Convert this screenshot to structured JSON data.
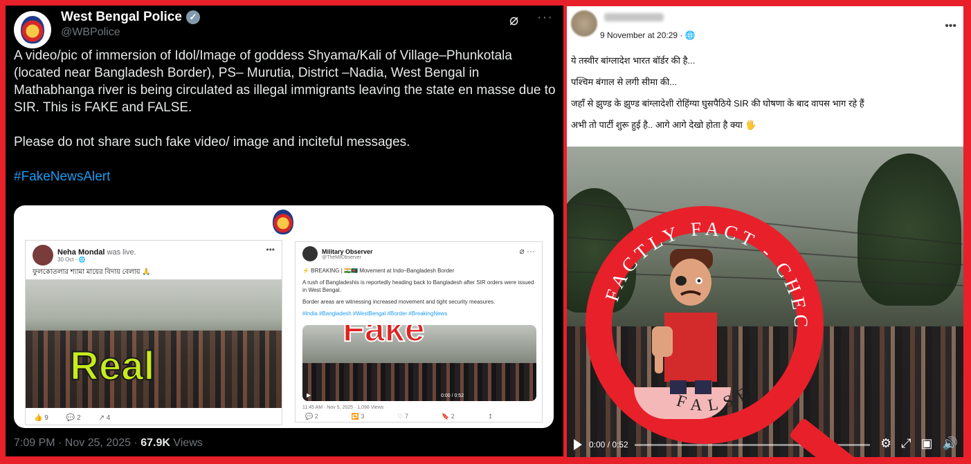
{
  "tweet": {
    "name": "West Bengal Police",
    "handle": "@WBPolice",
    "grok_icon": "slash-circle-icon",
    "more_icon": "ellipsis-icon",
    "paragraph_1": "A video/pic of immersion of Idol/Image of goddess Shyama/Kali  of Village–Phunkotala (located near Bangladesh Border), PS– Murutia, District –Nadia, West Bengal in Mathabhanga river is being circulated as illegal immigrants leaving the state en masse due to SIR. This is FAKE and FALSE.",
    "paragraph_2": "Please do not share such fake video/ image and inciteful messages.",
    "hashtag": "#FakeNewsAlert",
    "timestamp": "7:09 PM · Nov 25, 2025 · ",
    "views_count": "67.9K",
    "views_label": " Views",
    "media": {
      "left_card": {
        "name": "Neha Mondal",
        "name_suffix": " was live.",
        "date": "30 Oct · ",
        "caption": "ফুলকোতলার শ্যামা মায়ের বিদায় বেলায় 🙏",
        "stamp": "Real",
        "reactions": [
          "👍 9",
          "💬 2",
          "↗ 4"
        ]
      },
      "right_card": {
        "name": "Military Observer",
        "handle": "@TheMilObserver",
        "line_1": "⚡ BREAKING | 🇮🇳🇧🇩 Movement at Indo–Bangladesh Border",
        "line_2": "A rush of Bangladeshis is reportedly heading back to Bangladesh after SIR orders were issued in West Bengal.",
        "line_3": "Border areas are witnessing increased movement and tight security measures.",
        "hashtags": "#India #Bangladesh #WestBengal #Border #BreakingNews",
        "stamp": "Fake",
        "video_time": "0:00 / 0:52",
        "meta": "11:45 AM · Nov 5, 2025 · 1,098 Views",
        "actions": [
          "💬 2",
          "🔁 3",
          "♡ 7",
          "🔖 2",
          "↥"
        ]
      }
    }
  },
  "fb": {
    "time": "9 November at 20:29 · 🌐",
    "more": "•••",
    "line_1": "ये तस्वीर बांग्लादेश भारत बॉर्डर की है...",
    "line_2": "पश्चिम बंगाल से लगी सीमा की...",
    "line_3": "जहाँ से झुण्ड के झुण्ड बांग्लादेशी रोहिंग्या घुसपैठिये SIR की घोषणा के बाद वापस भाग रहे हैं",
    "line_4": "अभी तो पार्टी शुरू हुई है.. आगे आगे देखो होता है क्या 🖐",
    "video_time": "0:00 / 0:52",
    "video_icons": [
      "gear-icon",
      "fullscreen-icon",
      "pip-icon",
      "volume-icon"
    ]
  },
  "seal": {
    "top_text": "FACTLY FACT - CHECK",
    "bottom_text": "FALSE"
  },
  "colors": {
    "frame_red": "#e8202a",
    "twitter_bg": "#000000",
    "twitter_link": "#1d9bf0",
    "real_green": "#c6ec1c",
    "fake_red": "#e02222"
  }
}
